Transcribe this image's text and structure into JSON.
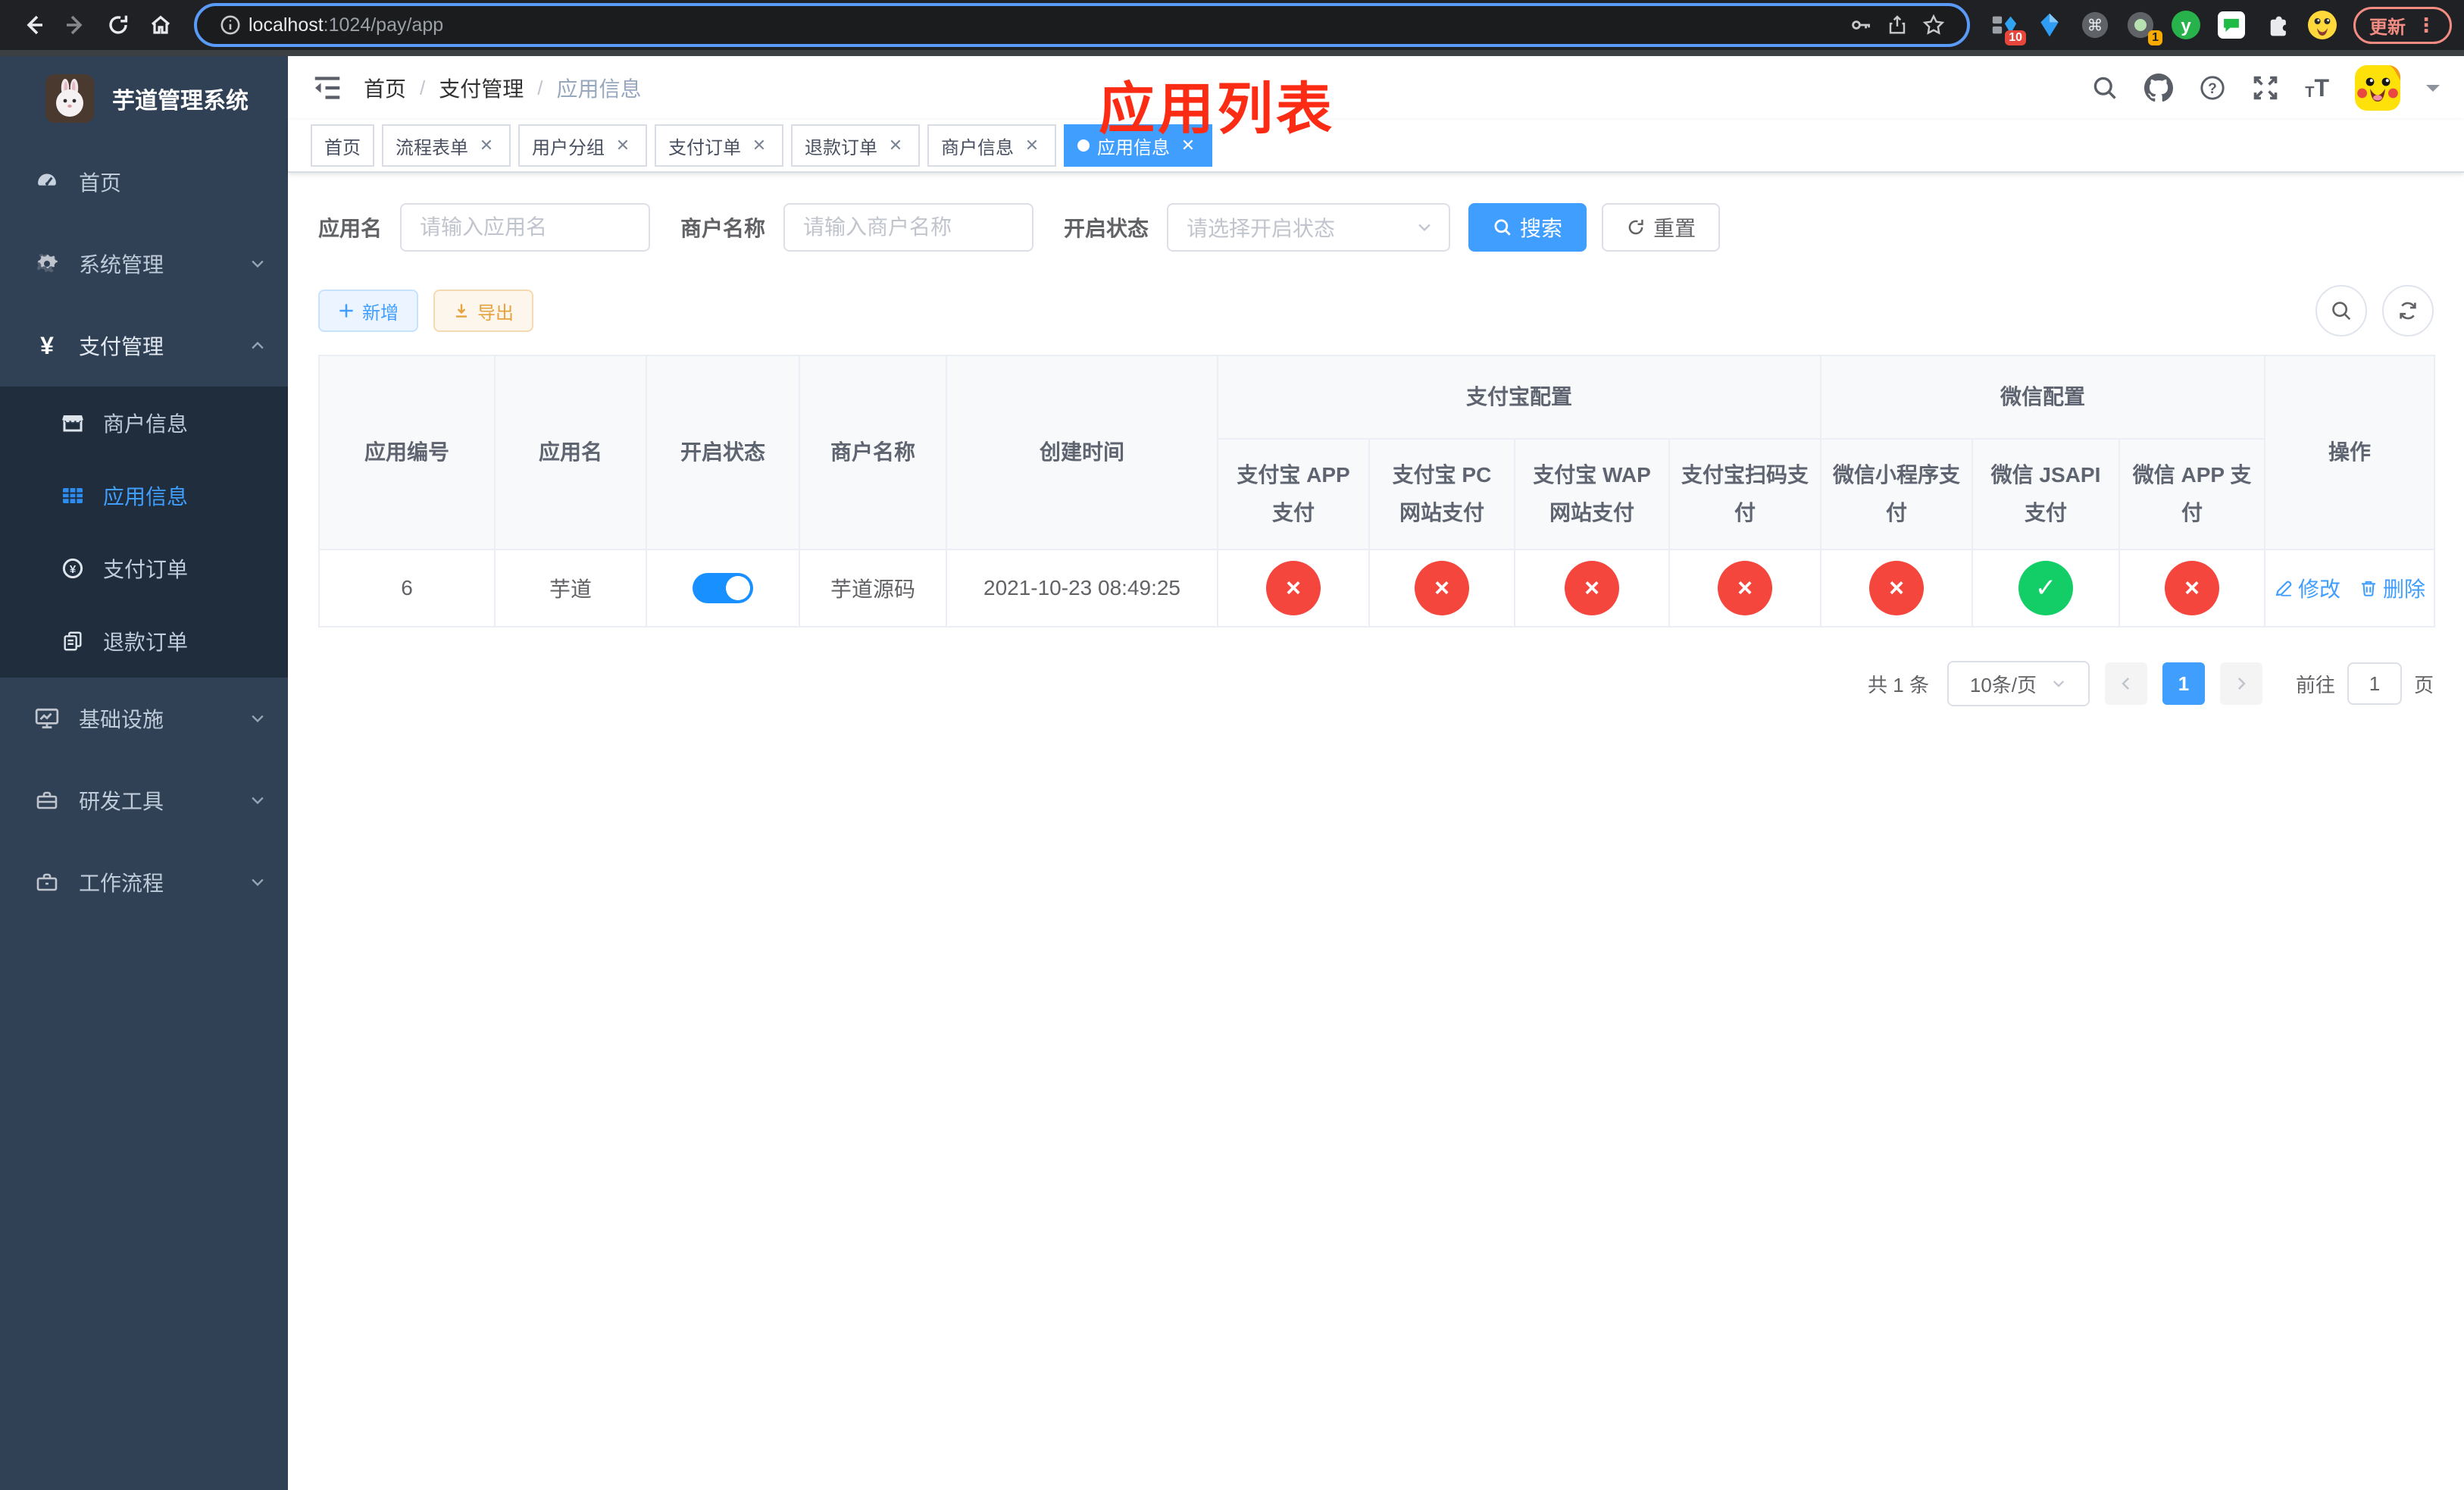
{
  "browser": {
    "url_host": "localhost",
    "url_rest": ":1024/pay/app",
    "update_button": "更新",
    "extensions": {
      "vue_badge": "10",
      "proxy_badge": "1",
      "y_letter": "y"
    }
  },
  "sidebar": {
    "title": "芋道管理系统",
    "items": [
      {
        "label": "首页"
      },
      {
        "label": "系统管理"
      },
      {
        "label": "支付管理",
        "children": [
          {
            "label": "商户信息"
          },
          {
            "label": "应用信息"
          },
          {
            "label": "支付订单"
          },
          {
            "label": "退款订单"
          }
        ]
      },
      {
        "label": "基础设施"
      },
      {
        "label": "研发工具"
      },
      {
        "label": "工作流程"
      }
    ]
  },
  "navbar": {
    "breadcrumb": [
      {
        "label": "首页"
      },
      {
        "label": "支付管理"
      },
      {
        "label": "应用信息"
      }
    ]
  },
  "annotation": "应用列表",
  "tags": [
    {
      "label": "首页"
    },
    {
      "label": "流程表单"
    },
    {
      "label": "用户分组"
    },
    {
      "label": "支付订单"
    },
    {
      "label": "退款订单"
    },
    {
      "label": "商户信息"
    },
    {
      "label": "应用信息"
    }
  ],
  "filters": {
    "app_name_label": "应用名",
    "app_name_placeholder": "请输入应用名",
    "merchant_label": "商户名称",
    "merchant_placeholder": "请输入商户名称",
    "status_label": "开启状态",
    "status_placeholder": "请选择开启状态",
    "search_button": "搜索",
    "reset_button": "重置"
  },
  "toolbar": {
    "add_button": "新增",
    "export_button": "导出"
  },
  "table": {
    "group_alipay": "支付宝配置",
    "group_wechat": "微信配置",
    "columns": [
      "应用编号",
      "应用名",
      "开启状态",
      "商户名称",
      "创建时间",
      "支付宝 APP 支付",
      "支付宝 PC 网站支付",
      "支付宝 WAP 网站支付",
      "支付宝扫码支付",
      "微信小程序支付",
      "微信 JSAPI 支付",
      "微信 APP 支付",
      "操作"
    ],
    "row": {
      "id": "6",
      "name": "芋道",
      "enabled": true,
      "merchant": "芋道源码",
      "created_at": "2021-10-23 08:49:25",
      "configs": [
        "no",
        "no",
        "no",
        "no",
        "no",
        "yes",
        "no"
      ],
      "edit_button": "修改",
      "delete_button": "删除"
    }
  },
  "pagination": {
    "total": "共 1 条",
    "page_size": "10条/页",
    "page": "1",
    "goto_label": "前往",
    "goto_value": "1",
    "goto_suffix": "页"
  },
  "colors": {
    "primary": "#409eff",
    "toggle_on": "#1890ff",
    "status_no": "#f5463d",
    "status_yes": "#13ce66",
    "annotation_red": "#fb2b14",
    "sidebar_bg": "#304156",
    "submenu_bg": "#1f2d3d"
  }
}
